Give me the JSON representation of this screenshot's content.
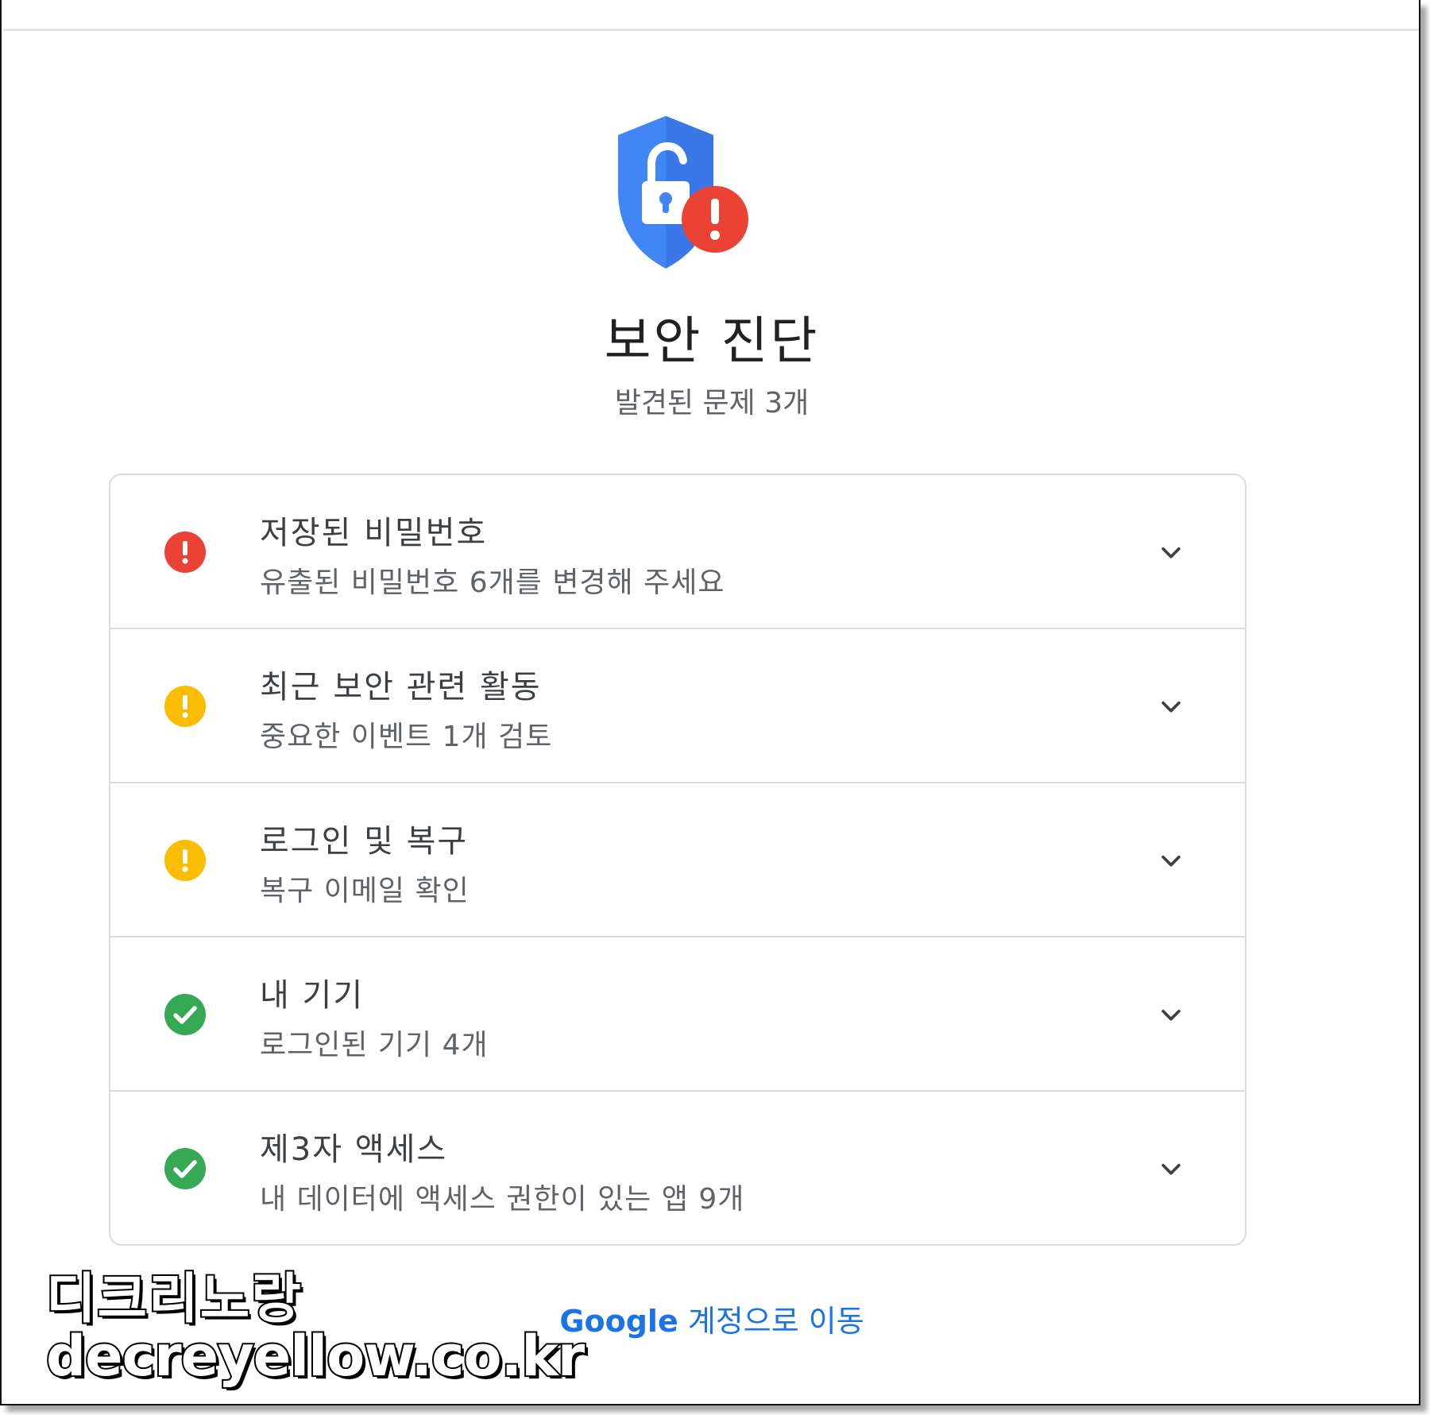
{
  "header": {
    "title": "보안 진단",
    "subtitle": "발견된 문제 3개"
  },
  "colors": {
    "red": "#ea4335",
    "yellow": "#fbbc04",
    "green": "#34a853",
    "blue": "#1a73e8",
    "shield": "#4285f4"
  },
  "items": [
    {
      "title": "저장된 비밀번호",
      "subtitle": "유출된 비밀번호 6개를 변경해 주세요",
      "status": "red-alert-icon"
    },
    {
      "title": "최근 보안 관련 활동",
      "subtitle": "중요한 이벤트 1개 검토",
      "status": "yellow-warning-icon"
    },
    {
      "title": "로그인 및 복구",
      "subtitle": "복구 이메일 확인",
      "status": "yellow-warning-icon"
    },
    {
      "title": "내 기기",
      "subtitle": "로그인된 기기 4개",
      "status": "green-check-icon"
    },
    {
      "title": "제3자 액세스",
      "subtitle": "내 데이터에 액세스 권한이 있는 앱 9개",
      "status": "green-check-icon"
    }
  ],
  "footer": {
    "brand": "Google",
    "link_text": " 계정으로 이동"
  },
  "watermark": {
    "line1": "디크리노랑",
    "line2": "decreyellow.co.kr"
  }
}
